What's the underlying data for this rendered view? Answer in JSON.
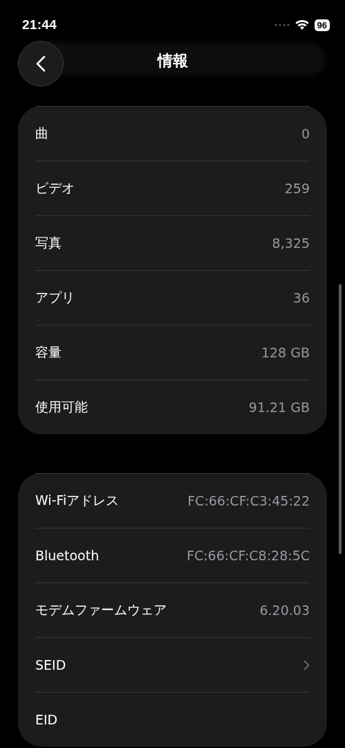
{
  "status_bar": {
    "time": "21:44",
    "battery": "96"
  },
  "header": {
    "title": "情報"
  },
  "sections": [
    {
      "rows": [
        {
          "kind": "value",
          "label": "曲",
          "value": "0"
        },
        {
          "kind": "value",
          "label": "ビデオ",
          "value": "259"
        },
        {
          "kind": "value",
          "label": "写真",
          "value": "8,325"
        },
        {
          "kind": "value",
          "label": "アプリ",
          "value": "36"
        },
        {
          "kind": "value",
          "label": "容量",
          "value": "128 GB"
        },
        {
          "kind": "value",
          "label": "使用可能",
          "value": "91.21 GB"
        }
      ]
    },
    {
      "rows": [
        {
          "kind": "value",
          "label": "Wi-Fiアドレス",
          "value": "FC:66:CF:C3:45:22"
        },
        {
          "kind": "value",
          "label": "Bluetooth",
          "value": "FC:66:CF:C8:28:5C"
        },
        {
          "kind": "value",
          "label": "モデムファームウェア",
          "value": "6.20.03"
        },
        {
          "kind": "link",
          "label": "SEID"
        },
        {
          "kind": "plain",
          "label": "EID"
        }
      ]
    }
  ]
}
